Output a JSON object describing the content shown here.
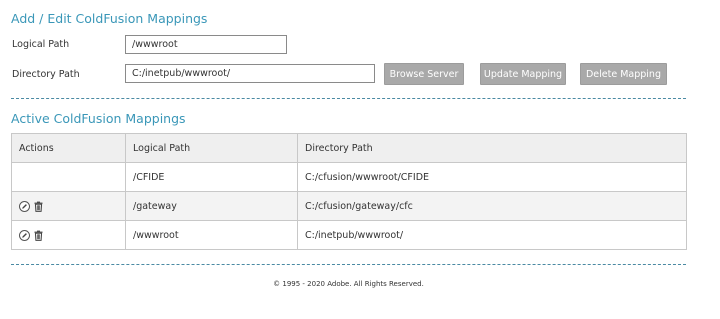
{
  "edit_section": {
    "title": "Add / Edit ColdFusion Mappings",
    "logical_path_label": "Logical Path",
    "logical_path_value": "/wwwroot",
    "directory_path_label": "Directory Path",
    "directory_path_value": "C:/inetpub/wwwroot/",
    "browse_button": "Browse Server",
    "update_button": "Update Mapping",
    "delete_button": "Delete Mapping"
  },
  "active_section": {
    "title": "Active ColdFusion Mappings",
    "columns": [
      "Actions",
      "Logical Path",
      "Directory Path"
    ],
    "rows": [
      {
        "logical": "/CFIDE",
        "directory": "C:/cfusion/wwwroot/CFIDE",
        "actions": []
      },
      {
        "logical": "/gateway",
        "directory": "C:/cfusion/gateway/cfc",
        "actions": [
          "edit-icon",
          "trash-icon"
        ]
      },
      {
        "logical": "/wwwroot",
        "directory": "C:/inetpub/wwwroot/",
        "actions": [
          "edit-icon",
          "trash-icon"
        ]
      }
    ]
  },
  "footer": {
    "copyright": "© 1995 - 2020 Adobe. All Rights Reserved."
  },
  "colors": {
    "accent": "#3a97b8",
    "button_bg": "#a9a9a9"
  }
}
